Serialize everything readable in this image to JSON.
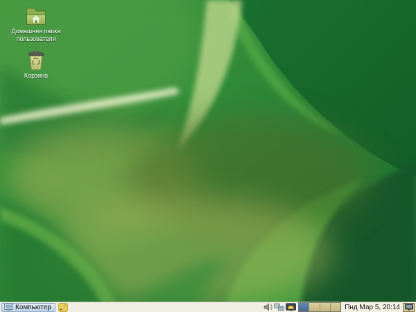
{
  "desktop": {
    "icons": [
      {
        "id": "home-folder",
        "label": "Домашняя папка пользователя",
        "icon": "home-folder-icon"
      },
      {
        "id": "trash",
        "label": "Корзина",
        "icon": "trash-bin-icon"
      }
    ]
  },
  "taskbar": {
    "computer_button": {
      "label": "Компьютер",
      "icon": "computer-monitor-icon"
    },
    "launcher": {
      "icon": "notes-pencil-icon"
    },
    "tray": [
      {
        "icon": "volume-speaker-icon"
      },
      {
        "icon": "network-computers-icon"
      },
      {
        "icon": "display-settings-icon"
      }
    ],
    "workspace_switcher": {
      "workspaces": 4,
      "active_index": 0
    },
    "clock": "Пнд Мар 5, 20:14",
    "corner_button": {
      "icon": "desktop-monitor-icon"
    }
  },
  "colors": {
    "taskbar_bg": "#f1eee4",
    "computer_button_bg": "#cddeec",
    "workspace_active": "#4e79a8",
    "workspace_inactive": "#cfc18b",
    "wallpaper_dark_green": "#145e28",
    "wallpaper_mid_green": "#2f8a38",
    "wallpaper_olive_glow": "#aab35c",
    "wallpaper_pale_streak": "#eef2cf"
  }
}
